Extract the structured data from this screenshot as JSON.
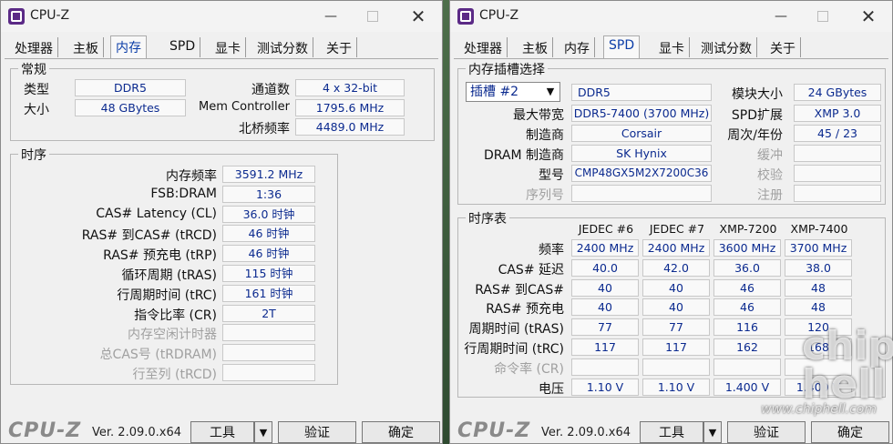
{
  "app": {
    "title": "CPU-Z",
    "brand": "CPU-Z",
    "version": "Ver. 2.09.0.x64"
  },
  "tabs": [
    "处理器",
    "主板",
    "内存",
    "SPD",
    "显卡",
    "测试分数",
    "关于"
  ],
  "footer": {
    "tools": "工具",
    "validate": "验证",
    "ok": "确定"
  },
  "memory": {
    "general": {
      "title": "常规",
      "type_label": "类型",
      "type_value": "DDR5",
      "size_label": "大小",
      "size_value": "48 GBytes",
      "channel_label": "通道数",
      "channel_value": "4 x 32-bit",
      "memctrl_label": "Mem Controller",
      "memctrl_value": "1795.6 MHz",
      "nb_label": "北桥频率",
      "nb_value": "4489.0 MHz"
    },
    "timings": {
      "title": "时序",
      "rows": [
        {
          "label": "内存频率",
          "value": "3591.2 MHz"
        },
        {
          "label": "FSB:DRAM",
          "value": "1:36"
        },
        {
          "label": "CAS# Latency (CL)",
          "value": "36.0 时钟"
        },
        {
          "label": "RAS# 到CAS# (tRCD)",
          "value": "46 时钟"
        },
        {
          "label": "RAS# 预充电 (tRP)",
          "value": "46 时钟"
        },
        {
          "label": "循环周期 (tRAS)",
          "value": "115 时钟"
        },
        {
          "label": "行周期时间 (tRC)",
          "value": "161 时钟"
        },
        {
          "label": "指令比率 (CR)",
          "value": "2T"
        },
        {
          "label": "内存空闲计时器",
          "value": ""
        },
        {
          "label": "总CAS号 (tRDRAM)",
          "value": ""
        },
        {
          "label": "行至列 (tRCD)",
          "value": ""
        }
      ]
    }
  },
  "spd": {
    "slot": {
      "title": "内存插槽选择",
      "selected": "插槽 #2",
      "type": "DDR5",
      "module_size_label": "模块大小",
      "module_size": "24 GBytes",
      "max_bw_label": "最大带宽",
      "max_bw": "DDR5-7400 (3700 MHz)",
      "spd_ext_label": "SPD扩展",
      "spd_ext": "XMP 3.0",
      "maker_label": "制造商",
      "maker": "Corsair",
      "week_year_label": "周次/年份",
      "week_year": "45 / 23",
      "dram_maker_label": "DRAM 制造商",
      "dram_maker": "SK Hynix",
      "buffer_label": "缓冲",
      "part_label": "型号",
      "part": "CMP48GX5M2X7200C36",
      "check_label": "校验",
      "serial_label": "序列号",
      "reg_label": "注册"
    },
    "timing_table": {
      "title": "时序表",
      "columns": [
        "JEDEC #6",
        "JEDEC #7",
        "XMP-7200",
        "XMP-7400"
      ],
      "rows": [
        {
          "label": "频率",
          "values": [
            "2400 MHz",
            "2400 MHz",
            "3600 MHz",
            "3700 MHz"
          ]
        },
        {
          "label": "CAS# 延迟",
          "values": [
            "40.0",
            "42.0",
            "36.0",
            "38.0"
          ]
        },
        {
          "label": "RAS# 到CAS#",
          "values": [
            "40",
            "40",
            "46",
            "48"
          ]
        },
        {
          "label": "RAS# 预充电",
          "values": [
            "40",
            "40",
            "46",
            "48"
          ]
        },
        {
          "label": "周期时间 (tRAS)",
          "values": [
            "77",
            "77",
            "116",
            "120"
          ]
        },
        {
          "label": "行周期时间 (tRC)",
          "values": [
            "117",
            "117",
            "162",
            "168"
          ]
        },
        {
          "label": "命令率 (CR)",
          "values": [
            "",
            "",
            "",
            ""
          ]
        },
        {
          "label": "电压",
          "values": [
            "1.10 V",
            "1.10 V",
            "1.400 V",
            "1.400 V"
          ]
        }
      ]
    }
  },
  "watermark": {
    "url": "www.chiphell.com",
    "logo": "chip hell"
  }
}
